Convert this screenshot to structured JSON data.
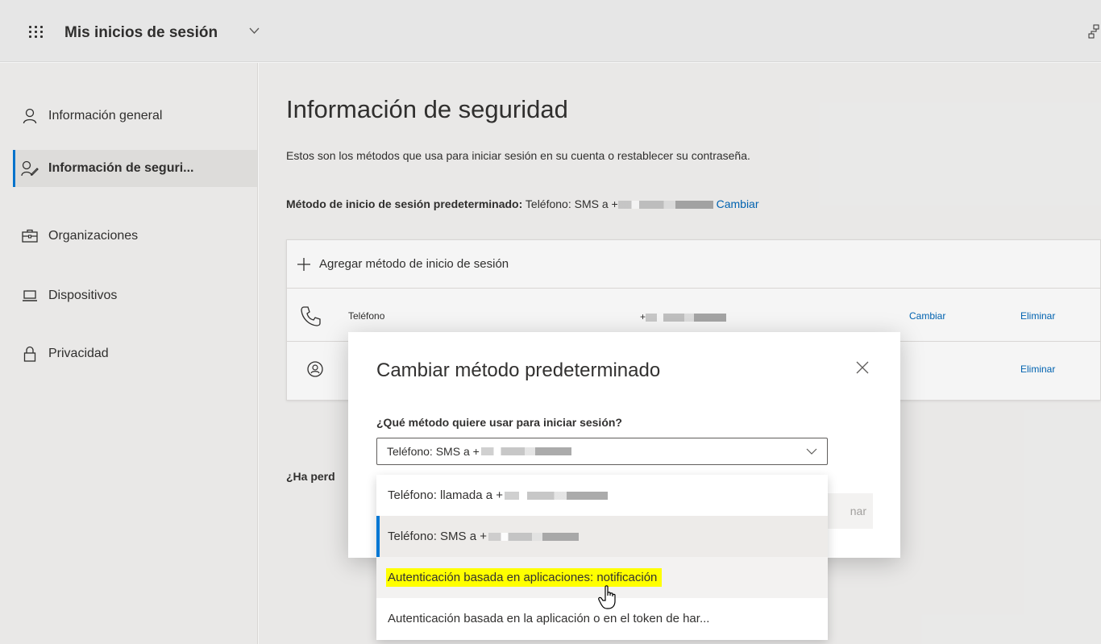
{
  "header": {
    "app_title": "Mis inicios de sesión",
    "icons": [
      "waffle-icon",
      "chevron-down-icon",
      "org-switch-icon"
    ]
  },
  "sidebar": {
    "items": [
      {
        "label": "Información general",
        "icon": "person-icon",
        "active": false
      },
      {
        "label": "Información de seguri...",
        "icon": "security-info-icon",
        "active": true
      },
      {
        "label": "Organizaciones",
        "icon": "briefcase-icon",
        "active": false
      },
      {
        "label": "Dispositivos",
        "icon": "laptop-icon",
        "active": false
      },
      {
        "label": "Privacidad",
        "icon": "lock-icon",
        "active": false
      }
    ]
  },
  "main": {
    "title": "Información de seguridad",
    "description": "Estos son los métodos que usa para iniciar sesión en su cuenta o restablecer su contraseña.",
    "default_method_label": "Método de inicio de sesión predeterminado:",
    "default_method_value": "Teléfono: SMS a +",
    "default_method_change": "Cambiar",
    "add_method": "Agregar método de inicio de sesión",
    "methods": [
      {
        "name": "Teléfono",
        "value": "+",
        "change": "Cambiar",
        "delete": "Eliminar",
        "icon": "phone-icon"
      },
      {
        "name": "",
        "value": "",
        "change": "",
        "delete": "Eliminar",
        "icon": "authenticator-icon"
      }
    ],
    "lost_device_prefix": "¿Ha perd"
  },
  "modal": {
    "title": "Cambiar método predeterminado",
    "question": "¿Qué método quiere usar para iniciar sesión?",
    "selected_value": "Teléfono: SMS a +",
    "confirm_button_partial": "nar",
    "options": [
      {
        "label": "Teléfono: llamada a +",
        "state": "normal"
      },
      {
        "label": "Teléfono: SMS a +",
        "state": "selected"
      },
      {
        "label": "Autenticación basada en aplicaciones: notificación",
        "state": "hover-highlighted"
      },
      {
        "label": "Autenticación basada en la aplicación o en el token de har...",
        "state": "normal"
      }
    ]
  },
  "colors": {
    "accent": "#0078d4",
    "link": "#0067b8",
    "highlight": "#ffff00"
  }
}
